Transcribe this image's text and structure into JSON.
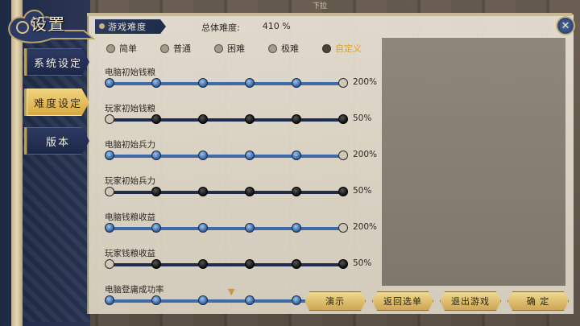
{
  "window": {
    "title": "设置",
    "top_tag": "下拉"
  },
  "sidebar": {
    "items": [
      {
        "label": "系统设定",
        "active": false
      },
      {
        "label": "难度设定",
        "active": true
      },
      {
        "label": "版本",
        "active": false
      }
    ]
  },
  "header": {
    "tab": "游戏难度",
    "total_label": "总体难度:",
    "total_value": "410 %"
  },
  "modes": [
    {
      "label": "简单",
      "selected": false
    },
    {
      "label": "普通",
      "selected": false
    },
    {
      "label": "困难",
      "selected": false
    },
    {
      "label": "极难",
      "selected": false
    },
    {
      "label": "自定义",
      "selected": true
    }
  ],
  "settings": [
    {
      "label": "电脑初始钱粮",
      "value": "200%",
      "level": 1.0
    },
    {
      "label": "玩家初始钱粮",
      "value": "50%",
      "level": 0.0
    },
    {
      "label": "电脑初始兵力",
      "value": "200%",
      "level": 1.0
    },
    {
      "label": "玩家初始兵力",
      "value": "50%",
      "level": 0.0
    },
    {
      "label": "电脑钱粮收益",
      "value": "200%",
      "level": 1.0
    },
    {
      "label": "玩家钱粮收益",
      "value": "50%",
      "level": 0.0
    },
    {
      "label": "电脑登庸成功率",
      "value": "",
      "level": 1.0
    }
  ],
  "buttons": {
    "demo": "演示",
    "back": "返回选单",
    "quit": "退出游戏",
    "confirm": "确 定"
  },
  "colors": {
    "accent": "#d6a33a",
    "navy": "#1f2c4c",
    "knob_blue": "#3d6aa8"
  }
}
